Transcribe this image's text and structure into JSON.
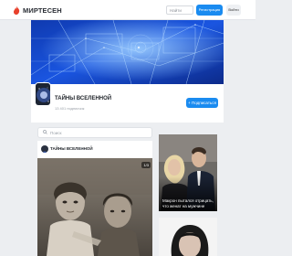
{
  "header": {
    "logo_text": "МИРТЕСЕН",
    "search_placeholder": "Найти",
    "register_label": "Регистрация",
    "login_label": "Войти"
  },
  "channel": {
    "title": "ТАЙНЫ ВСЕЛЕННОЙ",
    "subscribers": "13 401 подписчик",
    "subscribe_label": "Подписаться"
  },
  "feed": {
    "search_placeholder": "Поиск",
    "post": {
      "author": "ТАЙНЫ ВСЕЛЕННОЙ",
      "time": "8 ч",
      "photo_badge": "1/3"
    }
  },
  "sidebar": {
    "card1_caption": "Макрон пытался отрицать, что женат на мужчине"
  },
  "colors": {
    "accent": "#1a8bf0",
    "logo_red": "#e8412c",
    "banner_blue": "#1a4fd0"
  }
}
